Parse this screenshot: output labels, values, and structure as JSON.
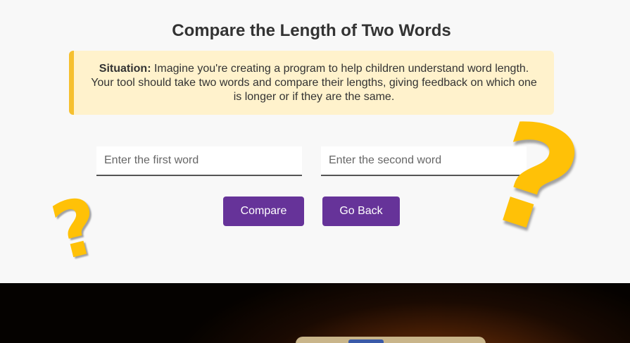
{
  "title": "Compare the Length of Two Words",
  "situation": {
    "label": "Situation:",
    "text": " Imagine you're creating a program to help children understand word length. Your tool should take two words and compare their lengths, giving feedback on which one is longer or if they are the same."
  },
  "inputs": {
    "first": {
      "placeholder": "Enter the first word",
      "value": ""
    },
    "second": {
      "placeholder": "Enter the second word",
      "value": ""
    }
  },
  "buttons": {
    "compare": "Compare",
    "back": "Go Back"
  },
  "decorations": {
    "question_mark": "?",
    "color": "#ffc107"
  },
  "colors": {
    "button": "#663399",
    "situation_bg": "#fff2cc",
    "situation_border": "#f6c02f"
  }
}
